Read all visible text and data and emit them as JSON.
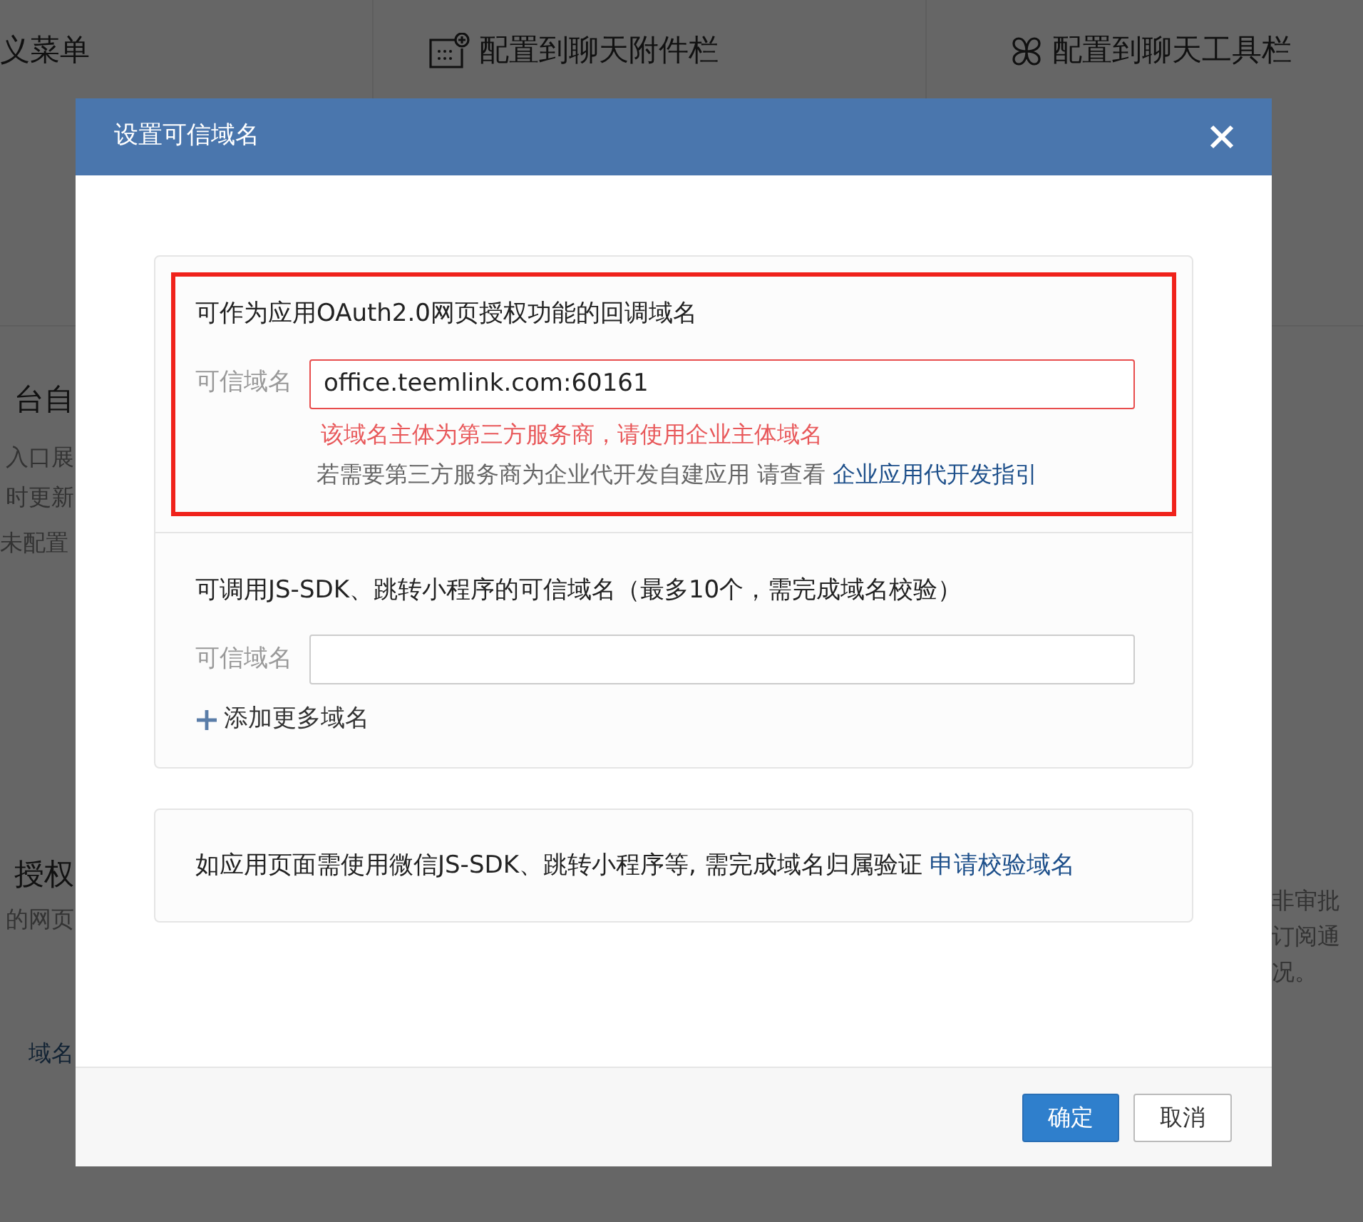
{
  "background": {
    "cards": [
      {
        "title": "义菜单",
        "kind": "plain"
      },
      {
        "title": "配置到聊天附件栏",
        "kind": "attachment"
      },
      {
        "title": "配置到聊天工具栏",
        "kind": "toolbar"
      }
    ],
    "left_items": [
      {
        "kind": "title",
        "text": "台自"
      },
      {
        "kind": "line",
        "text": "入口展"
      },
      {
        "kind": "line",
        "text": "时更新"
      },
      {
        "kind": "status",
        "text": "未配置"
      },
      {
        "kind": "title",
        "text": "授权"
      },
      {
        "kind": "line",
        "text": "的网页"
      },
      {
        "kind": "link",
        "text": "域名"
      }
    ],
    "right_items": [
      {
        "text": "非审批"
      },
      {
        "text": "订阅通"
      },
      {
        "text": "况。"
      }
    ]
  },
  "dialog": {
    "title": "设置可信域名",
    "sections": [
      {
        "heading": "可作为应用OAuth2.0网页授权功能的回调域名",
        "label": "可信域名",
        "value": "office.teemlink.com:60161",
        "invalid": true,
        "error": "该域名主体为第三方服务商，请使用企业主体域名",
        "hint": "若需要第三方服务商为企业代开发自建应用 请查看",
        "hint_link": "企业应用代开发指引",
        "highlighted": true
      },
      {
        "heading": "可调用JS-SDK、跳转小程序的可信域名（最多10个，需完成域名校验）",
        "label": "可信域名",
        "invalid": false,
        "add_link": "添加更多域名",
        "highlighted": false
      }
    ],
    "note": {
      "text": "如应用页面需使用微信JS-SDK、跳转小程序等, 需完成域名归属验证",
      "link": "申请校验域名"
    },
    "buttons": [
      {
        "label": "确定",
        "kind": "primary"
      },
      {
        "label": "取消",
        "kind": "secondary"
      }
    ]
  }
}
